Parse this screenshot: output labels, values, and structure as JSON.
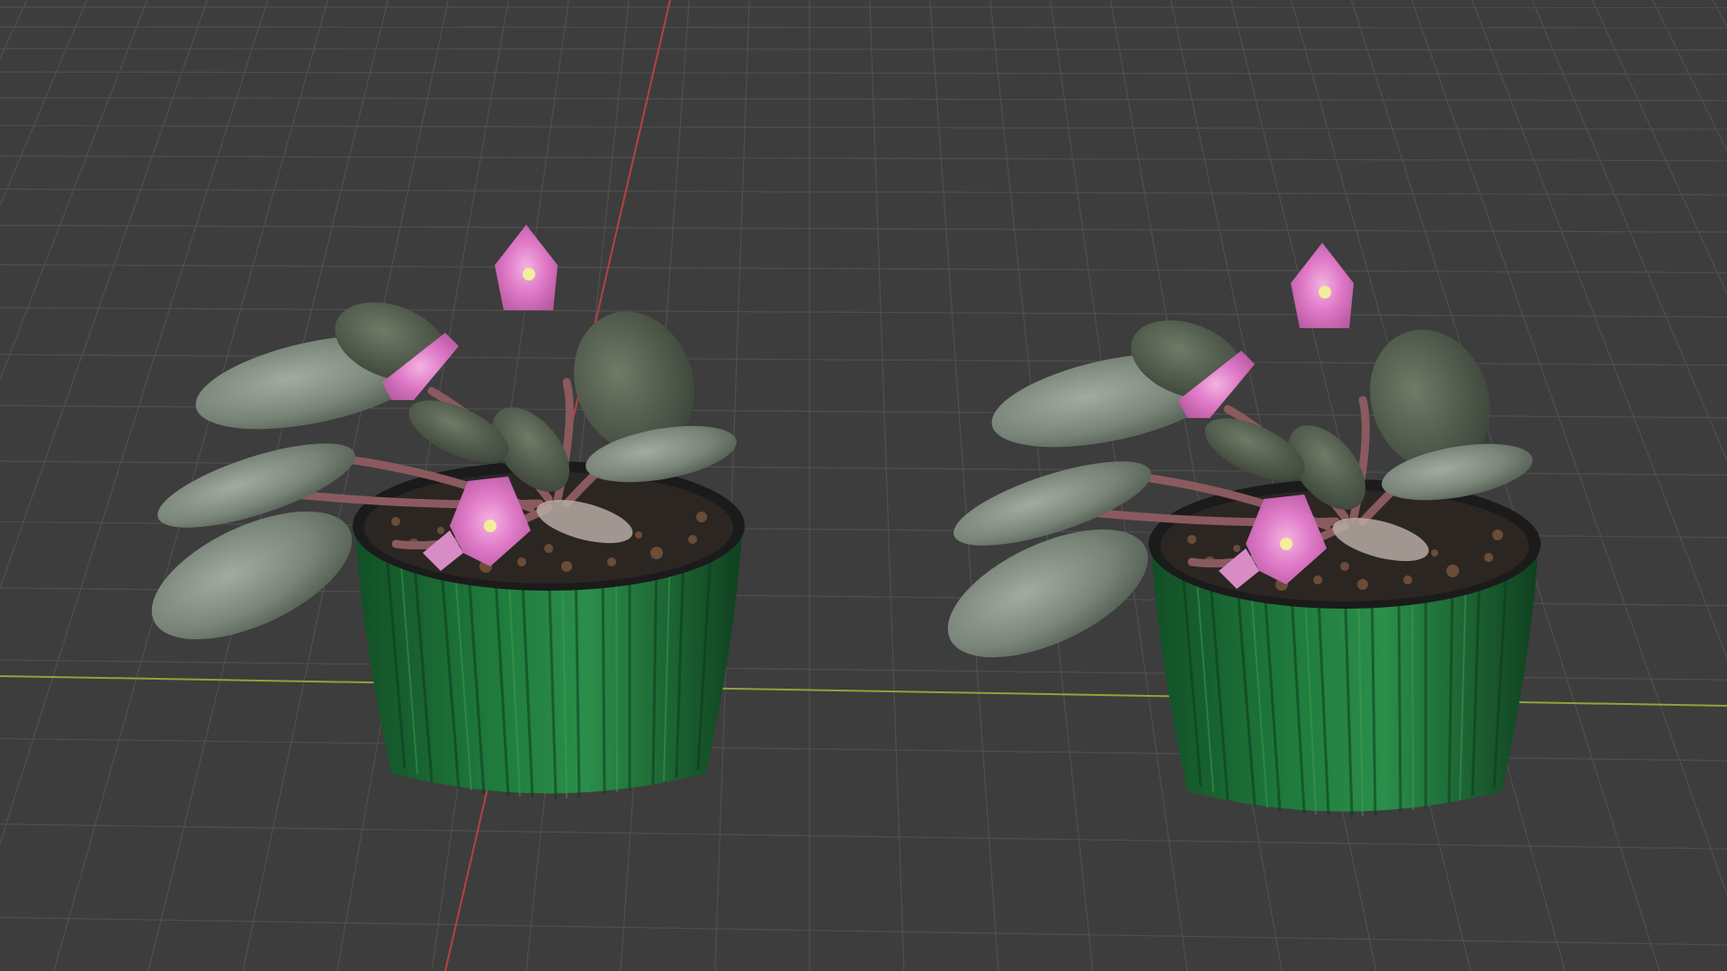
{
  "viewport": {
    "view": "perspective",
    "background_color": "#3d3d3d",
    "grid_color": "#4f4f4f",
    "axis_x_color": "#8fa43a",
    "axis_y_color": "#b8413f"
  },
  "objects": [
    {
      "name": "potted-african-violet",
      "pot_color": "#1f7a3c",
      "flower_color": "#e07ac8",
      "leaf_color": "#7f8c7e"
    },
    {
      "name": "potted-african-violet",
      "pot_color": "#1f7a3c",
      "flower_color": "#e07ac8",
      "leaf_color": "#7f8c7e"
    }
  ]
}
